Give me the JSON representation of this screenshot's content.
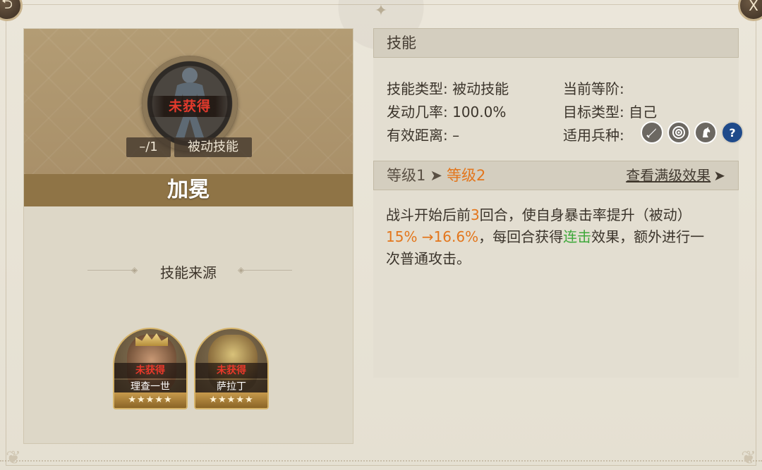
{
  "nav": {
    "back_icon": "back-arrow-icon",
    "close_icon": "close-x-icon",
    "close_label": "X"
  },
  "skill_card": {
    "unacquired_label": "未获得",
    "level_text": "–/1",
    "type_text": "被动技能",
    "name": "加冕"
  },
  "source": {
    "title": "技能来源",
    "heroes": [
      {
        "unacquired_label": "未获得",
        "name": "理查一世",
        "stars": "★★★★★"
      },
      {
        "unacquired_label": "未获得",
        "name": "萨拉丁",
        "stars": "★★★★★"
      }
    ]
  },
  "skill_info": {
    "header": "技能",
    "type_label": "技能类型:",
    "type_value": "被动技能",
    "rank_label": "当前等阶:",
    "rank_value": "",
    "rate_label": "发动几率:",
    "rate_value": "100.0%",
    "target_label": "目标类型:",
    "target_value": "自己",
    "range_label": "有效距离:",
    "range_value": "–",
    "troop_label": "适用兵种:",
    "troop_icons": [
      "sword-icon",
      "target-icon",
      "horse-icon",
      "help-icon"
    ]
  },
  "level": {
    "current": "等级1",
    "next": "等级2",
    "full_effect": "查看满级效果"
  },
  "description": {
    "p1": "战斗开始后前",
    "rounds": "3",
    "p2": "回合，使自身暴击率提升（被动）",
    "values": "15% →16.6%",
    "p3": "，每回合获得",
    "keyword": "连击",
    "p4": "效果，额外进行一次普通攻击。"
  },
  "colors": {
    "accent_orange": "#e3761c",
    "keyword_green": "#3ea83a",
    "unacquired_red": "#e23a2c",
    "name_bar": "#8f7446"
  }
}
